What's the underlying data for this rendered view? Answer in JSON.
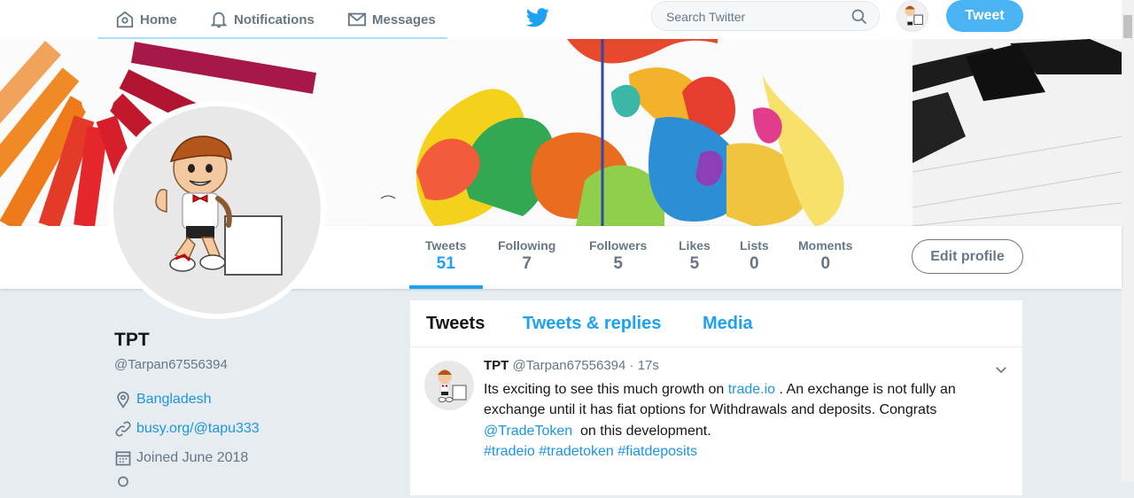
{
  "nav": {
    "home": "Home",
    "notifications": "Notifications",
    "messages": "Messages",
    "search_placeholder": "Search Twitter",
    "tweet_button": "Tweet"
  },
  "colors": {
    "accent": "#1da1f2",
    "text": "#14171a",
    "muted": "#657786",
    "background": "#e6ecf0"
  },
  "stats": [
    {
      "label": "Tweets",
      "value": "51"
    },
    {
      "label": "Following",
      "value": "7"
    },
    {
      "label": "Followers",
      "value": "5"
    },
    {
      "label": "Likes",
      "value": "5"
    },
    {
      "label": "Lists",
      "value": "0"
    },
    {
      "label": "Moments",
      "value": "0"
    }
  ],
  "edit_profile": "Edit profile",
  "profile": {
    "name": "TPT",
    "handle": "@Tarpan67556394",
    "location": "Bangladesh",
    "website": "busy.org/@tapu333",
    "joined": "Joined June 2018"
  },
  "timeline_tabs": [
    "Tweets",
    "Tweets & replies",
    "Media"
  ],
  "tweet": {
    "name": "TPT",
    "handle": "@Tarpan67556394",
    "separator": "·",
    "time": "17s",
    "line1_a": "Its exciting to see this much growth on ",
    "line1_link": "trade.io",
    "line1_b": " . An exchange is not fully an",
    "line2": "exchange until it has fiat options for Withdrawals and deposits. Congrats",
    "line3_mention": "@TradeToken",
    "line3_b": "  on this development.",
    "hashtags": "#tradeio #tradetoken #fiatdeposits"
  }
}
